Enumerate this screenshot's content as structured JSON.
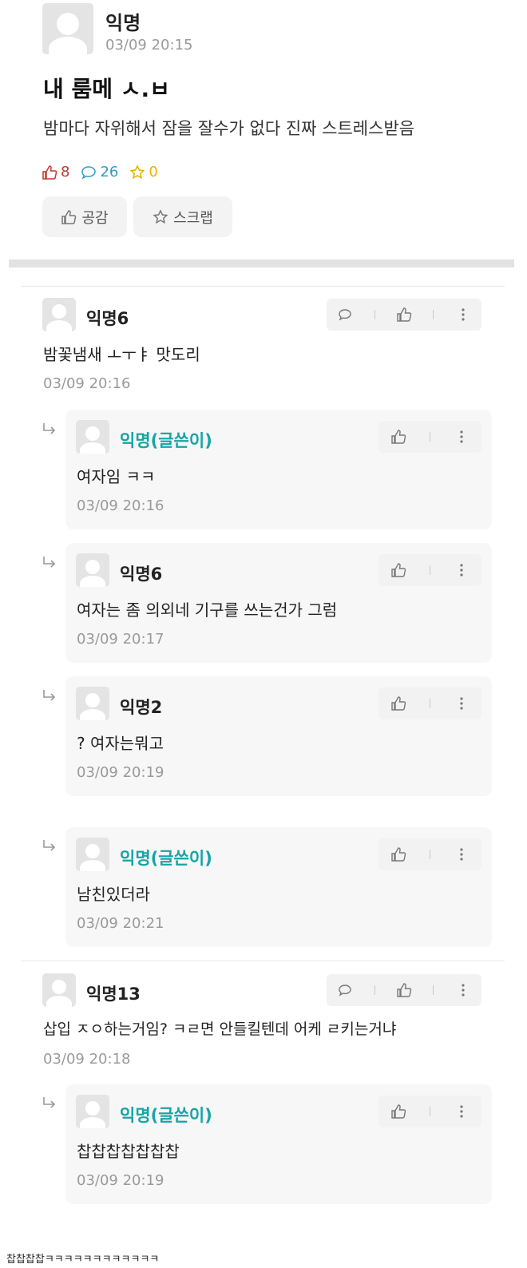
{
  "post": {
    "author": "익명",
    "time": "03/09 20:15",
    "title": "내 룸메 ㅅ.ㅂ",
    "body": "밤마다 자위해서 잠을 잘수가 없다 진짜 스트레스받음",
    "likes": "8",
    "comments": "26",
    "scraps": "0",
    "like_button": "공감",
    "scrap_button": "스크랩"
  },
  "comments": [
    {
      "name": "익명6",
      "text": "밤꽃냄새 ㅗㅜㅑ 맛도리",
      "time": "03/09 20:16",
      "replies": [
        {
          "name": "익명(글쓴이)",
          "text": "여자임 ㅋㅋ",
          "time": "03/09 20:16"
        },
        {
          "name": "익명6",
          "text": "여자는 좀 의외네 기구를 쓰는건가 그럼",
          "time": "03/09 20:17"
        },
        {
          "name": "익명2",
          "text": "? 여자는뭐고",
          "time": "03/09 20:19"
        },
        {
          "name": "익명(글쓴이)",
          "text": "남친있더라",
          "time": "03/09 20:21"
        }
      ]
    },
    {
      "name": "익명13",
      "text": "삽입 ㅈㅇ하는거임? ㅋㄹ면 안들킬텐데 어케 ㄹ키는거냐",
      "time": "03/09 20:18",
      "replies": [
        {
          "name": "익명(글쓴이)",
          "text": "찹찹찹찹찹찹찹",
          "time": "03/09 20:19"
        }
      ]
    }
  ],
  "footer": "찹찹찹찹ㅋㅋㅋㅋㅋㅋㅋㅋㅋㅋㅋㅋ",
  "colors": {
    "author_name": "#18a4a4",
    "like": "#c0392b",
    "comment": "#2c9ec6",
    "scrap": "#e0b400"
  }
}
